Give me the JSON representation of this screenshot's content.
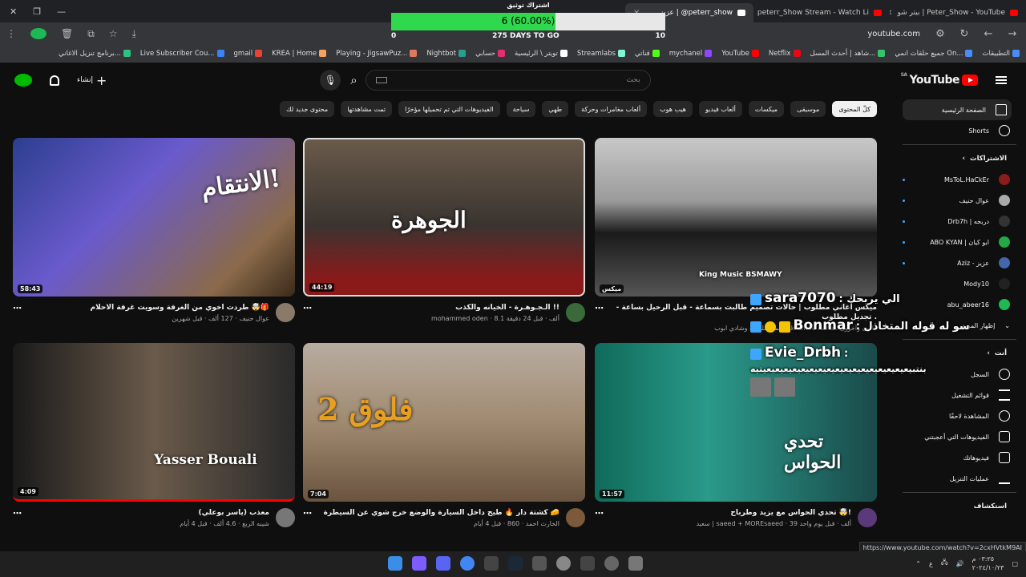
{
  "browser": {
    "tabs": [
      {
        "title": "بيتر شو | Peter_Show - YouTube",
        "active": false,
        "icon": "youtube-icon"
      },
      {
        "title": "peterr_Show Stream - Watch Li",
        "active": false,
        "icon": "youtube-icon"
      },
      {
        "title": "عزيز | @peterr_show",
        "active": true,
        "icon": "x-icon"
      },
      {
        "title": "",
        "active": false,
        "icon": "youtube-icon"
      }
    ],
    "url": "youtube.com",
    "bookmarks": [
      "التطبيقات",
      "جميع حلقات انمي On...",
      "شاهد | أحدث المسل...",
      "Netflix",
      "YouTube",
      "mychanel",
      "قناتي",
      "Streamlabs",
      "تويتر \\ الرئيسية",
      "حسابي",
      "Nightbot",
      "Playing - JigsawPuz...",
      "KREA | Home",
      "gmail",
      "Live Subscriber Cou...",
      "برنامج تنزيل الاغاني..."
    ]
  },
  "goal": {
    "title": "اشتراك توثيق",
    "progress_text": "6 (60.00%)",
    "progress": 0.6,
    "start": "0",
    "end": "10",
    "days_left": "275 DAYS TO GO"
  },
  "youtube": {
    "logo": "YouTube",
    "region": "SA",
    "search_placeholder": "بحث",
    "create_label": "إنشاء",
    "chips": [
      "كلّ المحتوى",
      "موسيقى",
      "ميكسات",
      "ألعاب فيديو",
      "هيب هوب",
      "ألعاب مغامرات وحركة",
      "طهي",
      "سياحة",
      "الفيديوهات التي تم تحميلها مؤخرًا",
      "تمت مشاهدتها",
      "محتوى جديد لك"
    ],
    "sidebar": {
      "home": "الصفحة الرئيسية",
      "shorts": "Shorts",
      "subs_header": "الاشتراكات",
      "subs": [
        {
          "name": "MsToL.HaCkEr",
          "color": "#8b1c1c",
          "dot": true
        },
        {
          "name": "عوال حنيف",
          "color": "#aaa",
          "dot": true
        },
        {
          "name": "Drb7h | دربحه",
          "color": "#333",
          "dot": true
        },
        {
          "name": "ABO KYAN | ابو كيان",
          "color": "#2a4",
          "dot": true
        },
        {
          "name": "Aziz - عزيز",
          "color": "#4466aa",
          "dot": true
        },
        {
          "name": "Mody10",
          "color": "#222",
          "dot": false
        },
        {
          "name": "abu_abeer16",
          "color": "#1db954",
          "dot": false
        }
      ],
      "show_more": "إظهار المزيد",
      "you_header": "أنت",
      "you_items": [
        "السجل",
        "قوائم التشغيل",
        "المشاهدة لاحقًا",
        "الفيديوهات التي أعجبتني",
        "فيديوهاتك",
        "عمليات التنزيل"
      ],
      "explore": "استكشاف"
    },
    "videos": [
      {
        "title": "طردت اخوي من الغرفة وسويت غرفة الاحلام 🤯🎁",
        "channel": "عوال حنيف",
        "stats": "127 ألف · قبل شهرين",
        "duration": "58:43",
        "thumb_text": "الانتقام!",
        "avatar": "#8a7a6a"
      },
      {
        "title": "الـجـوهـرة - الخيانه والكذب !!",
        "channel": "mohammed oden",
        "stats": "8.1 ألف · قبل 24 دقيقة",
        "duration": "44:19",
        "thumb_text": "الجوهرة",
        "avatar": "#3a6a3a"
      },
      {
        "title": "ميكس أغاني مطلوب | حالات تصميم طالبت بسماعة - قبل الرحيل بساعة - تجديل مطلوب .",
        "channel": "عمر سليمان وشادي ابوب، Akram Al Rahal، قانون وآخرون",
        "stats": "",
        "duration": "ميكس",
        "thumb_text": "King Music BSMAWY",
        "avatar": ""
      },
      {
        "title": "معذب (ياسر بوعلي)",
        "channel": "شيبه الربع",
        "stats": "4.6 ألف · قبل 4 أيام",
        "duration": "4:09",
        "thumb_text": "Yasser Bouali",
        "avatar": "#777"
      },
      {
        "title": "كشتة دار 🔥 طيح داخل السيارة والوضع خرج شوي عن السيطرة 🧀",
        "channel": "الحارث احمد",
        "stats": "860 · قبل 4 أيام",
        "duration": "7:04",
        "thumb_text": "فلوق 2",
        "avatar": "#7a5a3a"
      },
      {
        "title": "تحدي الحواس مع يزيد وطرباح 🤯!",
        "channel": "سعيد | saeed + MOREsaeed",
        "stats": "39 ألف · قبل يوم واحد",
        "duration": "11:57",
        "thumb_text": "تحدي الحواس",
        "avatar": "#5a3a7a"
      }
    ],
    "status_url": "https://www.youtube.com/watch?v=2cxHVtkM9AI"
  },
  "chat": [
    {
      "user": "sara7070",
      "message": "الي يربحك"
    },
    {
      "user": "Bonmar",
      "message": "سو له قوله المتخاذل"
    },
    {
      "user": "Evie_Drbh",
      "message": "بنتبيعيعيعيعيعيعيعيعيعيعيعيعيعيعيعيعيعيتيه"
    }
  ],
  "taskbar": {
    "time": "٠٣:٢٥ م",
    "date": "٢٠٢٤/١٠/٢٣",
    "lang": "ع"
  }
}
